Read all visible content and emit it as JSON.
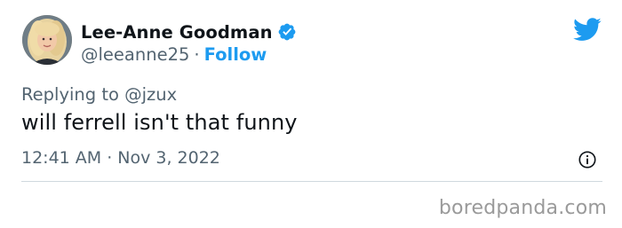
{
  "author": {
    "display_name": "Lee-Anne Goodman",
    "handle": "@leeanne25",
    "separator": "·",
    "follow_label": "Follow",
    "verified_icon": "verified-badge-icon",
    "avatar_icon": "profile-photo"
  },
  "brand_icon": "twitter-bird-icon",
  "tweet": {
    "replying_to": "Replying to @jzux",
    "text": "will ferrell isn't that funny",
    "time": "12:41 AM",
    "meta_separator": "·",
    "date": "Nov 3, 2022",
    "info_icon": "info-icon"
  },
  "watermark": "boredpanda.com",
  "colors": {
    "accent": "#1d9bf0",
    "text": "#0f1419",
    "muted": "#536471",
    "divider": "#cfd9de",
    "watermark": "#9a9a9a"
  }
}
